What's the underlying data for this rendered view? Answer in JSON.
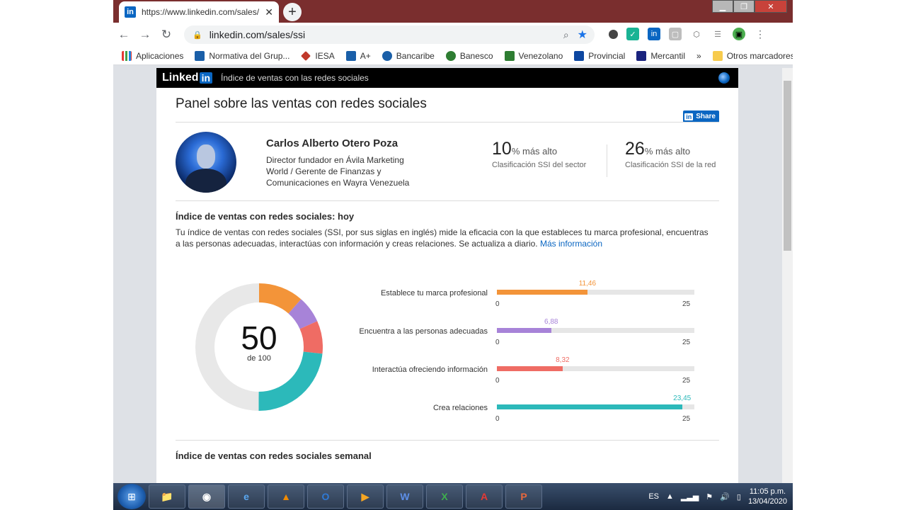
{
  "browser": {
    "tab_title": "https://www.linkedin.com/sales/s",
    "tab_close": "✕",
    "new_tab": "+",
    "url": "linkedin.com/sales/ssi",
    "window_controls": [
      "▁",
      "❐",
      "✕"
    ],
    "bookmarks": [
      {
        "label": "Aplicaciones",
        "color": "#e8710a"
      },
      {
        "label": "Normativa del Grup...",
        "color": "#1a5fa8"
      },
      {
        "label": "IESA",
        "color": "#c0392b"
      },
      {
        "label": "A+",
        "color": "#1a5fa8"
      },
      {
        "label": "Bancaribe",
        "color": "#1a5fa8"
      },
      {
        "label": "Banesco",
        "color": "#2e7d32"
      },
      {
        "label": "Venezolano",
        "color": "#2e7d32"
      },
      {
        "label": "Provincial",
        "color": "#0d47a1"
      },
      {
        "label": "Mercantil",
        "color": "#1a237e"
      }
    ],
    "bookmarks_more": "»",
    "other_bookmarks": "Otros marcadores"
  },
  "linkedin": {
    "logo_text": "Linked",
    "logo_in": "in",
    "header_subtitle": "Índice de ventas con las redes sociales",
    "page_title": "Panel sobre las ventas con redes sociales",
    "share_label": "Share",
    "share_icon": "in",
    "profile": {
      "name": "Carlos Alberto Otero Poza",
      "headline": "Director fundador en Ávila Marketing World / Gerente de Finanzas y Comunicaciones en Wayra Venezuela"
    },
    "ranks": [
      {
        "value": "10",
        "suffix": "% más alto",
        "label": "Clasificación SSI del sector"
      },
      {
        "value": "26",
        "suffix": "% más alto",
        "label": "Clasificación SSI de la red"
      }
    ],
    "ssi_title": "Índice de ventas con redes sociales: hoy",
    "ssi_description": "Tu índice de ventas con redes sociales (SSI, por sus siglas en inglés) mide la eficacia con la que estableces tu marca profesional, encuentras a las personas adecuadas, interactúas con información y creas relaciones. Se actualiza a diario.",
    "more_info": "Más información",
    "score": "50",
    "score_total": "de 100",
    "weekly_title": "Índice de ventas con redes sociales semanal"
  },
  "chart_data": {
    "type": "bar",
    "orientation": "horizontal",
    "categories": [
      "Establece tu marca profesional",
      "Encuentra a las personas adecuadas",
      "Interactúa ofreciendo información",
      "Crea relaciones"
    ],
    "values": [
      11.46,
      6.88,
      8.32,
      23.45
    ],
    "value_labels": [
      "11,46",
      "6,88",
      "8,32",
      "23,45"
    ],
    "colors": [
      "#f39439",
      "#a783d8",
      "#ef6c64",
      "#2cb9ba"
    ],
    "xlim": [
      0,
      25
    ],
    "tick_labels": [
      "0",
      "25"
    ],
    "donut": {
      "total": 100,
      "remainder_color": "#e8e8e8"
    }
  },
  "taskbar": {
    "apps": [
      "📁",
      "◉",
      "e",
      "▲",
      "O",
      "▶",
      "W",
      "X",
      "A",
      "P"
    ],
    "language": "ES",
    "time": "11:05 p.m.",
    "date": "13/04/2020"
  }
}
